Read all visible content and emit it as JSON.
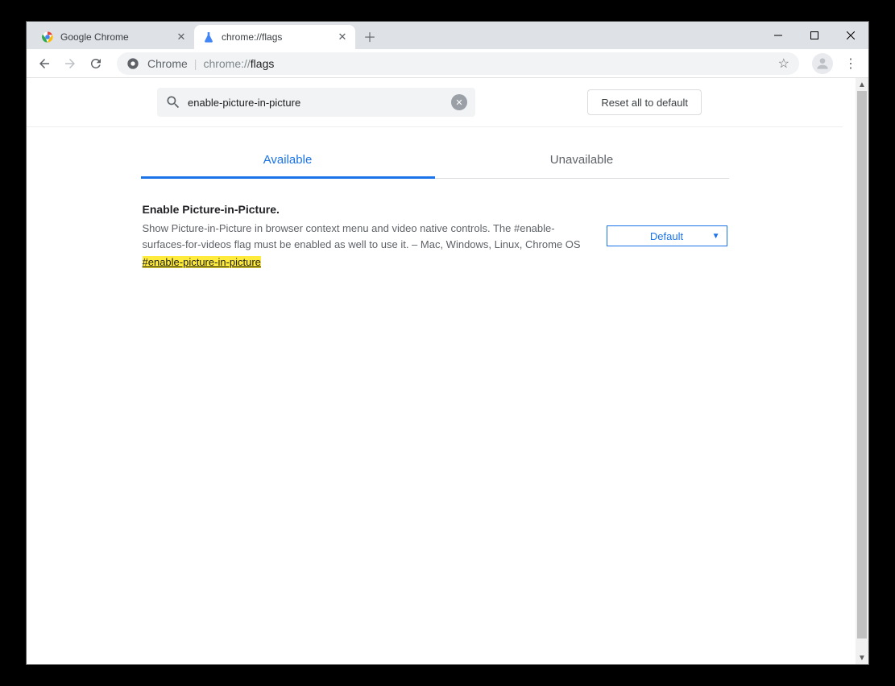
{
  "tabs": [
    {
      "title": "Google Chrome",
      "active": false
    },
    {
      "title": "chrome://flags",
      "active": true
    }
  ],
  "omnibox": {
    "secure_label": "Chrome",
    "url_prefix": "chrome://",
    "url_page": "flags"
  },
  "flags": {
    "search_value": "enable-picture-in-picture",
    "reset_label": "Reset all to default",
    "tab_available": "Available",
    "tab_unavailable": "Unavailable",
    "experiment": {
      "title": "Enable Picture-in-Picture.",
      "description": "Show Picture-in-Picture in browser context menu and video native controls. The #enable-surfaces-for-videos flag must be enabled as well to use it. – Mac, Windows, Linux, Chrome OS",
      "link_hash": "#",
      "link_slug": "enable-picture-in-picture",
      "select_value": "Default"
    }
  }
}
